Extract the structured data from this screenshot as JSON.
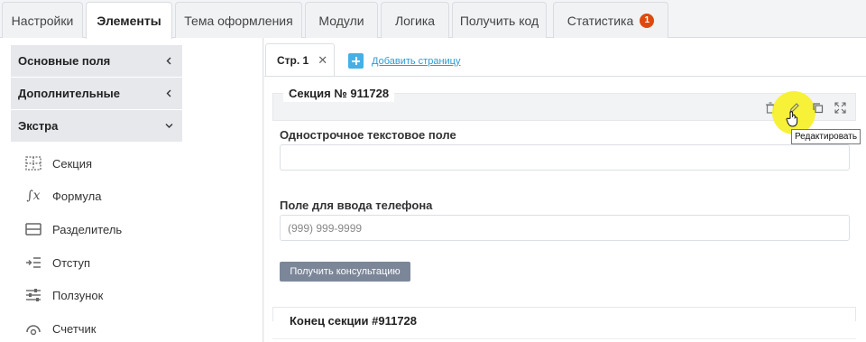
{
  "top_tabs": [
    {
      "label": "Настройки"
    },
    {
      "label": "Элементы"
    },
    {
      "label": "Тема оформления"
    },
    {
      "label": "Модули"
    },
    {
      "label": "Логика"
    },
    {
      "label": "Получить код"
    },
    {
      "label": "Статистика",
      "badge": "1"
    }
  ],
  "sidebar": {
    "groups": [
      {
        "label": "Основные поля",
        "state": "collapsed"
      },
      {
        "label": "Дополнительные",
        "state": "collapsed"
      },
      {
        "label": "Экстра",
        "state": "expanded"
      }
    ],
    "items": [
      {
        "label": "Секция",
        "icon": "section-icon"
      },
      {
        "label": "Формула",
        "icon": "formula-icon"
      },
      {
        "label": "Разделитель",
        "icon": "divider-icon"
      },
      {
        "label": "Отступ",
        "icon": "indent-icon"
      },
      {
        "label": "Ползунок",
        "icon": "slider-icon"
      },
      {
        "label": "Счетчик",
        "icon": "counter-icon"
      }
    ]
  },
  "page_tab": {
    "label": "Стр. 1",
    "close": "✕"
  },
  "add_page": {
    "label": "Добавить страницу"
  },
  "section": {
    "title": "Секция № 911728",
    "end_title": "Конец секции #911728",
    "tooltip": "Редактировать"
  },
  "fields": [
    {
      "label": "Однострочное текстовое поле",
      "placeholder": ""
    },
    {
      "label": "Поле для ввода телефона",
      "placeholder": "(999) 999-9999"
    }
  ],
  "submit_button": {
    "label": "Получить конcультацию"
  },
  "colors": {
    "accent": "#2a9bd8",
    "badge": "#e0480d",
    "button": "#7b8799",
    "highlight": "#f7f12c"
  }
}
